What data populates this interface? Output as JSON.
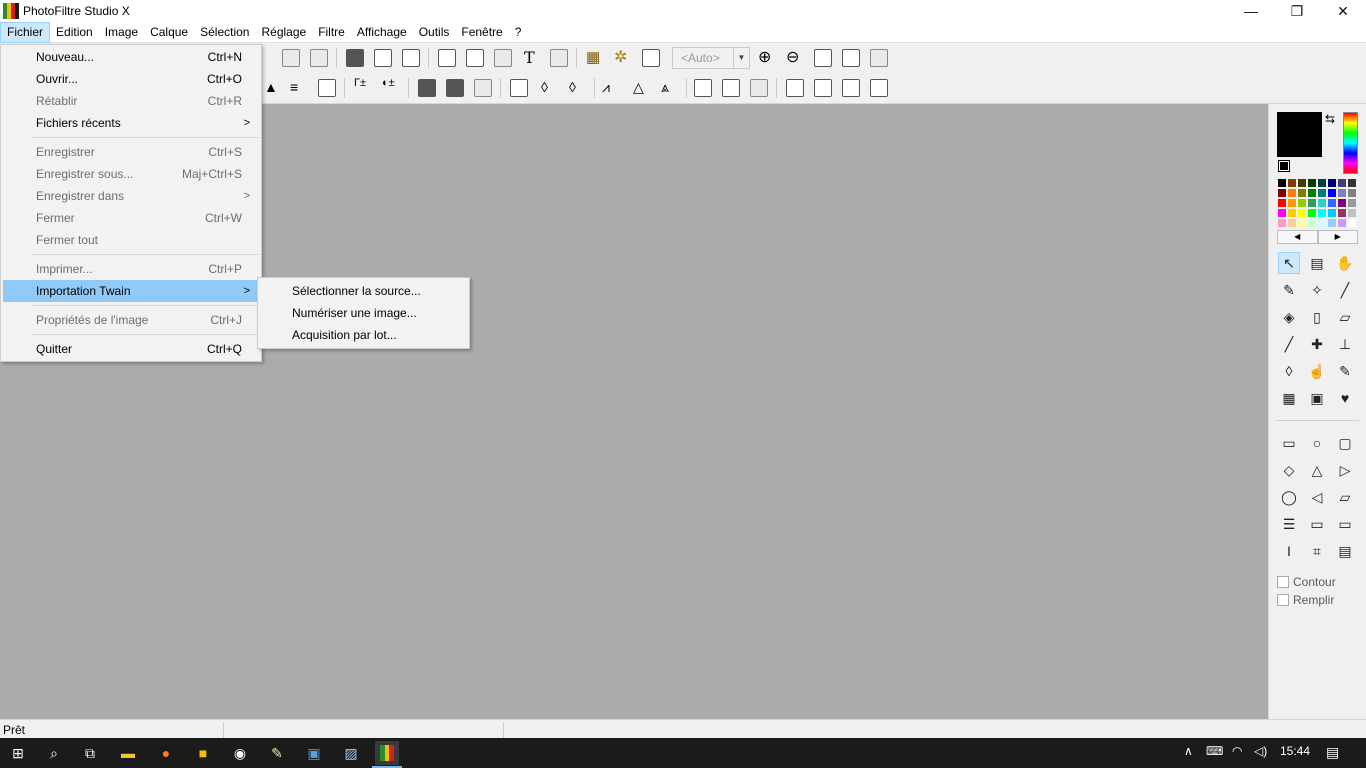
{
  "window": {
    "title": "PhotoFiltre Studio X",
    "minimize": "—",
    "restore": "❐",
    "close": "✕"
  },
  "menubar": [
    "Fichier",
    "Edition",
    "Image",
    "Calque",
    "Sélection",
    "Réglage",
    "Filtre",
    "Affichage",
    "Outils",
    "Fenêtre",
    "?"
  ],
  "toolbar": {
    "zoom_value": "<Auto>"
  },
  "file_menu": {
    "items": [
      {
        "label": "Nouveau...",
        "shortcut": "Ctrl+N",
        "enabled": true
      },
      {
        "label": "Ouvrir...",
        "shortcut": "Ctrl+O",
        "enabled": true
      },
      {
        "label": "Rétablir",
        "shortcut": "Ctrl+R",
        "enabled": false
      },
      {
        "label": "Fichiers récents",
        "shortcut": "",
        "enabled": true,
        "submenu": true
      },
      {
        "label": "Enregistrer",
        "shortcut": "Ctrl+S",
        "enabled": false
      },
      {
        "label": "Enregistrer sous...",
        "shortcut": "Maj+Ctrl+S",
        "enabled": false
      },
      {
        "label": "Enregistrer dans",
        "shortcut": "",
        "enabled": false,
        "submenu": true
      },
      {
        "label": "Fermer",
        "shortcut": "Ctrl+W",
        "enabled": false
      },
      {
        "label": "Fermer tout",
        "shortcut": "",
        "enabled": false
      },
      {
        "label": "Imprimer...",
        "shortcut": "Ctrl+P",
        "enabled": false
      },
      {
        "label": "Importation Twain",
        "shortcut": "",
        "enabled": true,
        "submenu": true,
        "highlighted": true
      },
      {
        "label": "Propriétés de l'image",
        "shortcut": "Ctrl+J",
        "enabled": false
      },
      {
        "label": "Quitter",
        "shortcut": "Ctrl+Q",
        "enabled": true
      }
    ]
  },
  "twain_submenu": [
    "Sélectionner la source...",
    "Numériser une image...",
    "Acquisition par lot..."
  ],
  "tool_options": {
    "contour": "Contour",
    "remplir": "Remplir"
  },
  "statusbar": {
    "text": "Prêt"
  },
  "taskbar": {
    "time": "15:44"
  },
  "colors": {
    "foreground": "#000000",
    "workspace": "#ababab",
    "highlight": "#91c9f7"
  }
}
